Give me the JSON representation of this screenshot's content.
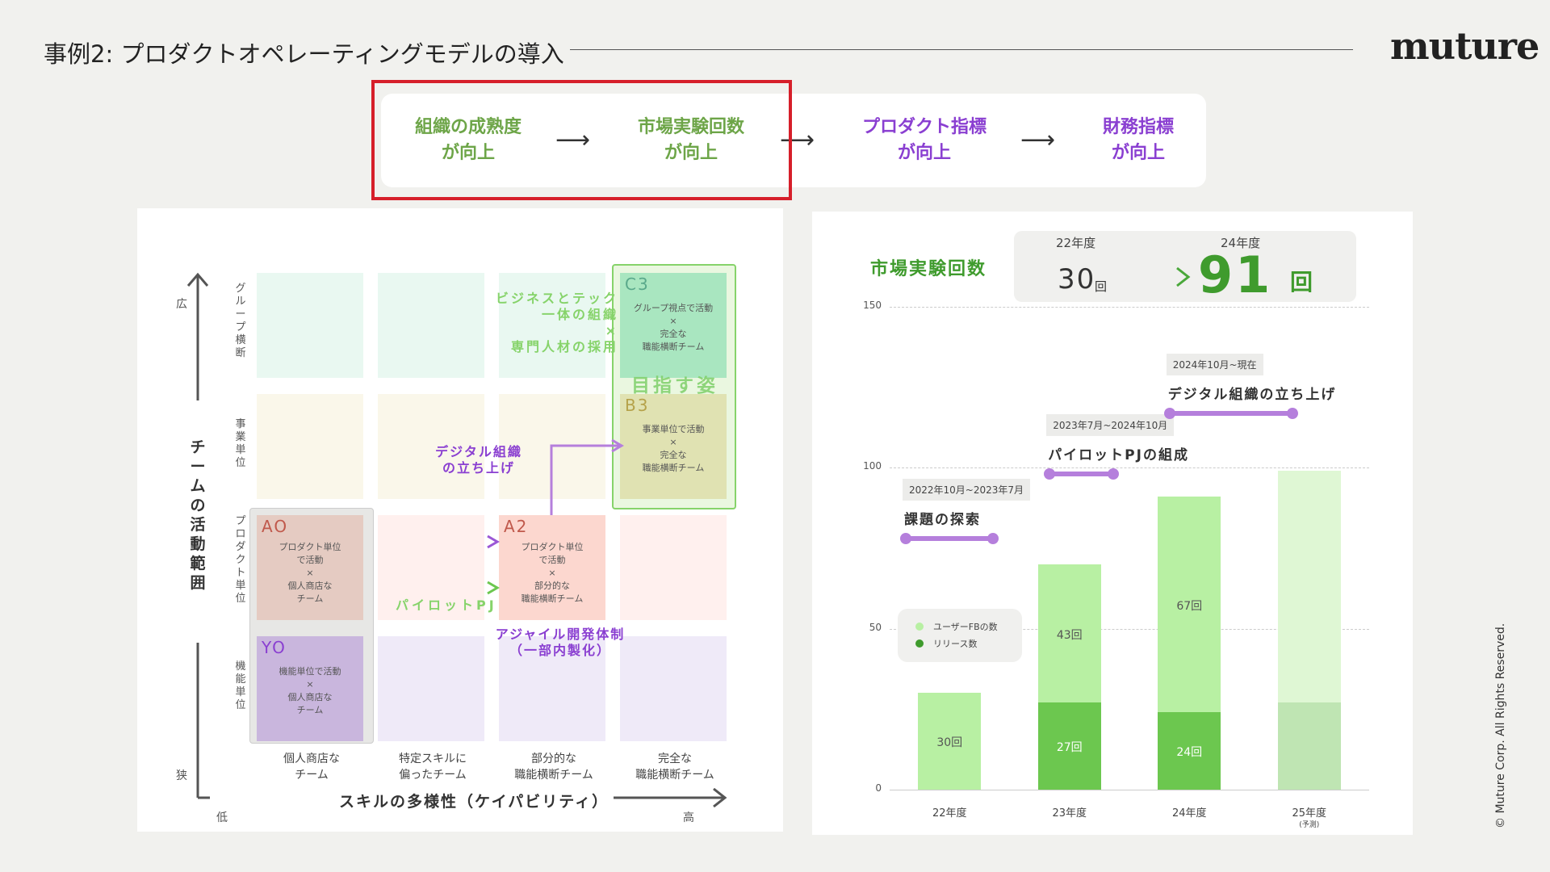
{
  "header": {
    "title": "事例2: プロダクトオペレーティングモデルの導入",
    "logo": "muture",
    "copyright": "© Muture Corp. All Rights Reserved."
  },
  "flow": {
    "steps": [
      {
        "line1": "組織の成熟度",
        "line2": "が向上",
        "color": "#6da548"
      },
      {
        "line1": "市場実験回数",
        "line2": "が向上",
        "color": "#6da548"
      },
      {
        "line1": "プロダクト指標",
        "line2": "が向上",
        "color": "#8a3fd1"
      },
      {
        "line1": "財務指標",
        "line2": "が向上",
        "color": "#8a3fd1"
      }
    ],
    "arrow": "⟶"
  },
  "matrix": {
    "y_axis_title": "チームの活動範囲",
    "y_high": "広",
    "y_low": "狭",
    "x_axis_title": "スキルの多様性（ケイパビリティ）",
    "x_low": "低",
    "x_high": "高",
    "row_labels": [
      "グループ横断",
      "事業単位",
      "プロダクト単位",
      "機能単位"
    ],
    "col_labels": [
      "個人商店な\nチーム",
      "特定スキルに\n偏ったチーム",
      "部分的な\n職能横断チーム",
      "完全な\n職能横断チーム"
    ],
    "cells": {
      "C3": {
        "code": "C3",
        "text": "グループ視点で活動\n×\n完全な\n職能横断チーム"
      },
      "B3": {
        "code": "B3",
        "text": "事業単位で活動\n×\n完全な\n職能横断チーム"
      },
      "A0": {
        "code": "AO",
        "text": "プロダクト単位\nで活動\n×\n個人商店な\nチーム"
      },
      "A2": {
        "code": "A2",
        "text": "プロダクト単位\nで活動\n×\n部分的な\n職能横断チーム"
      },
      "Y0": {
        "code": "YO",
        "text": "機能単位で活動\n×\n個人商店な\nチーム"
      }
    },
    "annotations": {
      "biz_tech": "ビジネスとテック\n一体の組織\n×\n専門人材の採用",
      "goal": "目指す姿",
      "digital": "デジタル組織\nの立ち上げ",
      "pilot": "パイロットPJ",
      "agile": "アジャイル開発体制\n（一部内製化）"
    }
  },
  "chart_header": {
    "title": "市場実験回数",
    "from_year": "22年度",
    "from_value": "30",
    "to_year": "24年度",
    "to_value": "91",
    "unit": "回",
    "arrow": "⟶"
  },
  "chart_data": {
    "type": "bar",
    "stacked": true,
    "categories": [
      "22年度",
      "23年度",
      "24年度",
      "25年度"
    ],
    "category_notes": [
      "",
      "",
      "",
      "(予測)"
    ],
    "series": [
      {
        "name": "リリース数",
        "values": [
          null,
          27,
          24,
          27
        ],
        "color": "#6cc74f"
      },
      {
        "name": "ユーザーFBの数",
        "values": [
          30,
          43,
          67,
          72
        ],
        "color": "#b8f0a3"
      }
    ],
    "data_labels": {
      "リリース数": [
        "",
        "27回",
        "24回",
        ""
      ],
      "ユーザーFBの数": [
        "30回",
        "43回",
        "67回",
        ""
      ]
    },
    "ylim": [
      0,
      150
    ],
    "yticks": [
      0,
      50,
      100,
      150
    ],
    "grid": true,
    "legend_placement": "left",
    "phases": [
      {
        "date": "2022年10月~2023年7月",
        "title": "課題の探索",
        "start": 0,
        "end": 1.2,
        "level": 78
      },
      {
        "date": "2023年7月~2024年10月",
        "title": "パイロットPJの組成",
        "start": 1.2,
        "end": 2.2,
        "level": 98
      },
      {
        "date": "2024年10月~現在",
        "title": "デジタル組織の立ち上げ",
        "start": 2.2,
        "end": 3.7,
        "level": 117
      }
    ]
  }
}
